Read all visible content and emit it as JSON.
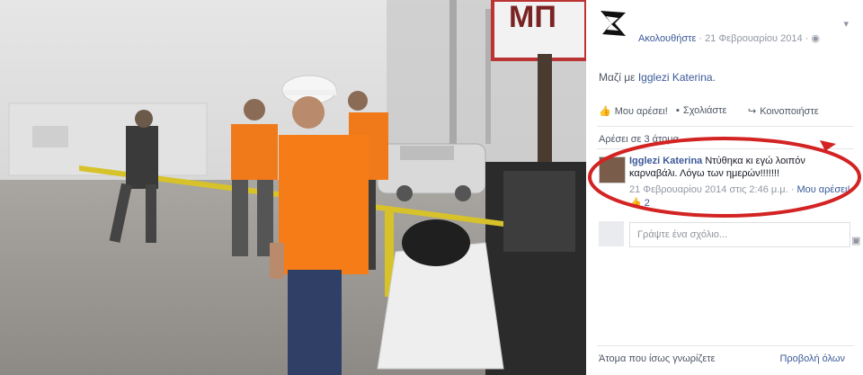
{
  "post": {
    "follow_label": "Ακολουθήστε",
    "date": "21 Φεβρουαρίου 2014",
    "separator": "·",
    "caption_prefix": "Μαζί με",
    "caption_name": "Igglezi Katerina",
    "caption_suffix": "."
  },
  "actions": {
    "like": "Μου αρέσει!",
    "comment": "Σχολιάστε",
    "share": "Κοινοποιήστε"
  },
  "likes_summary": "Αρέσει σε 3 άτομα.",
  "comment": {
    "author": "Igglezi Katerina",
    "text": "Ντύθηκα κι εγώ λοιπόν καρναβάλι. Λόγω των ημερών!!!!!!!",
    "timestamp": "21 Φεβρουαρίου 2014 στις 2:46 μ.μ.",
    "dot": "·",
    "like_link": "Μου αρέσει!",
    "like_count": "2"
  },
  "write_comment": {
    "placeholder": "Γράψτε ένα σχόλιο..."
  },
  "people": {
    "label": "Άτομα που ίσως γνωρίζετε",
    "see_all": "Προβολή όλων"
  },
  "colors": {
    "link": "#3b5998",
    "annotation": "#d32323"
  }
}
